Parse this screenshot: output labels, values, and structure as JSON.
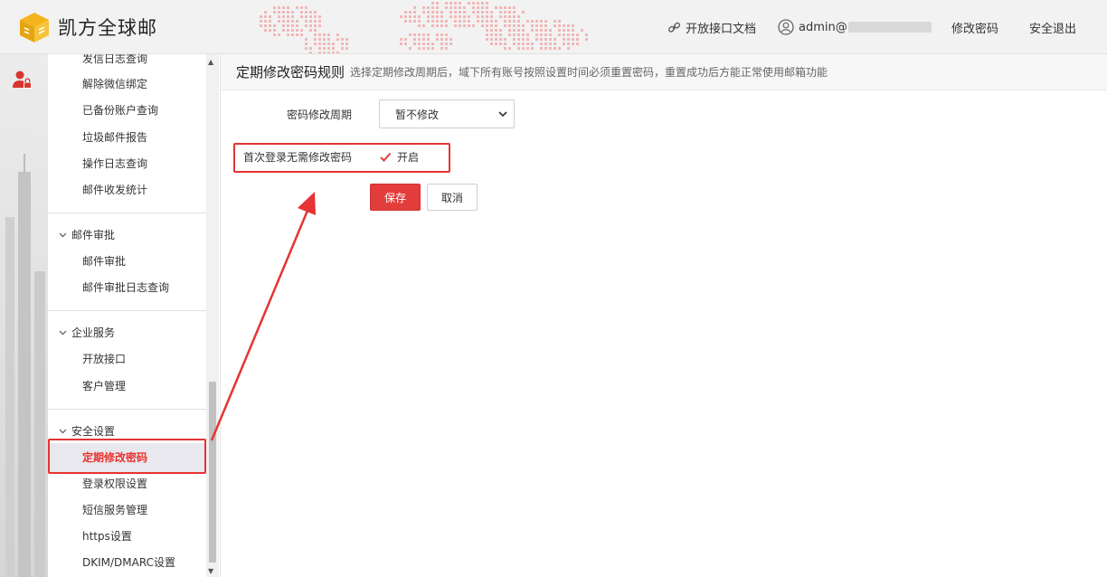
{
  "header": {
    "brand": "凯方全球邮",
    "api_docs_label": "开放接口文档",
    "user_label": "admin@",
    "change_password_label": "修改密码",
    "logout_label": "安全退出"
  },
  "sidebar": {
    "items_top": [
      "发信日志查询",
      "解除微信绑定",
      "已备份账户查询",
      "垃圾邮件报告",
      "操作日志查询",
      "邮件收发统计"
    ],
    "group_mail_approval": "邮件审批",
    "items_mail_approval": [
      "邮件审批",
      "邮件审批日志查询"
    ],
    "group_enterprise": "企业服务",
    "items_enterprise": [
      "开放接口",
      "客户管理"
    ],
    "group_security": "安全设置",
    "items_security": [
      "定期修改密码",
      "登录权限设置",
      "短信服务管理",
      "https设置",
      "DKIM/DMARC设置"
    ],
    "active_item": "定期修改密码"
  },
  "page": {
    "title": "定期修改密码规则",
    "description": "选择定期修改周期后，域下所有账号按照设置时间必须重置密码，重置成功后方能正常使用邮箱功能"
  },
  "form": {
    "period_label": "密码修改周期",
    "period_value": "暂不修改",
    "first_login_label": "首次登录无需修改密码",
    "first_login_option": "开启",
    "first_login_checked": true,
    "save_label": "保存",
    "cancel_label": "取消"
  },
  "colors": {
    "accent": "#e23c3c",
    "active_text": "#e8322d",
    "annotation": "#e63333"
  }
}
